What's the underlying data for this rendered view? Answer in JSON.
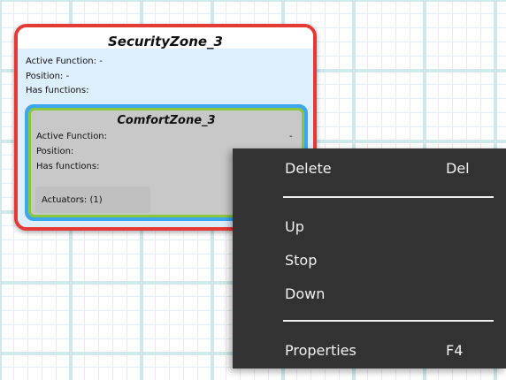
{
  "security_zone": {
    "title": "SecurityZone_3",
    "active_function_label": "Active Function: -",
    "position_label": "Position: -",
    "has_functions_label": "Has functions:"
  },
  "comfort_zone": {
    "title": "ComfortZone_3",
    "active_function_label": "Active Function:",
    "active_function_value": "-",
    "position_label": "Position:",
    "has_functions_label": "Has functions:",
    "actuators_label": "Actuators: (1)"
  },
  "context_menu": {
    "items": [
      {
        "label": "Delete",
        "shortcut": "Del"
      },
      {
        "label": "Up",
        "shortcut": ""
      },
      {
        "label": "Stop",
        "shortcut": ""
      },
      {
        "label": "Down",
        "shortcut": ""
      },
      {
        "label": "Properties",
        "shortcut": "F4"
      }
    ]
  },
  "colors": {
    "security_border": "#e53935",
    "comfort_outer_border": "#3aa7f0",
    "comfort_inner_border": "#8cc63f",
    "menu_background": "#323232"
  }
}
